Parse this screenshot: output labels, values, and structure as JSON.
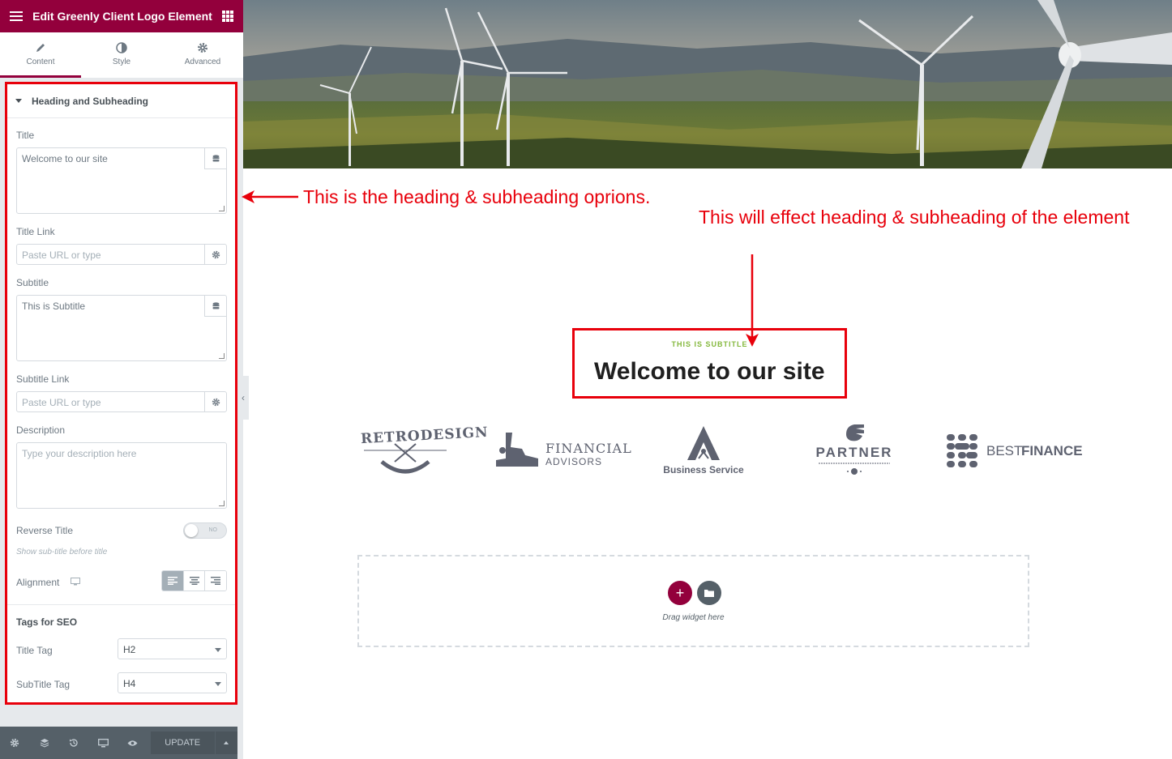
{
  "panel": {
    "header_title": "Edit Greenly Client Logo Element",
    "tabs": [
      {
        "label": "Content",
        "icon": "pencil-icon"
      },
      {
        "label": "Style",
        "icon": "half-circle-icon"
      },
      {
        "label": "Advanced",
        "icon": "gear-icon"
      }
    ],
    "section_title": "Heading and Subheading",
    "title_label": "Title",
    "title_value": "Welcome to our site",
    "title_link_label": "Title Link",
    "title_link_placeholder": "Paste URL or type",
    "subtitle_label": "Subtitle",
    "subtitle_value": "This is Subtitle",
    "subtitle_link_label": "Subtitle Link",
    "subtitle_link_placeholder": "Paste URL or type",
    "description_label": "Description",
    "description_placeholder": "Type your description here",
    "reverse_title_label": "Reverse Title",
    "reverse_toggle_text": "NO",
    "reverse_hint": "Show sub-title before title",
    "alignment_label": "Alignment",
    "seo_heading": "Tags for SEO",
    "title_tag_label": "Title Tag",
    "title_tag_value": "H2",
    "subtitle_tag_label": "SubTitle Tag",
    "subtitle_tag_value": "H4",
    "update_label": "UPDATE"
  },
  "annotations": {
    "left_note": "This is the heading & subheading oprions.",
    "right_note": "This will effect heading & subheading of the element"
  },
  "preview": {
    "subtitle": "THIS IS SUBTITLE",
    "title": "Welcome to our site",
    "logos": {
      "retro": "RETRODESIGN",
      "financial_1": "FINANCIAL",
      "financial_2": "ADVISORS",
      "business": "Business Service",
      "partner": "PARTNER",
      "best_1": "BEST",
      "best_2": "FINANCE"
    },
    "drop_text": "Drag widget here"
  },
  "colors": {
    "brand": "#93003c",
    "annotation": "#e8000b",
    "subtitle_green": "#84b83c"
  }
}
